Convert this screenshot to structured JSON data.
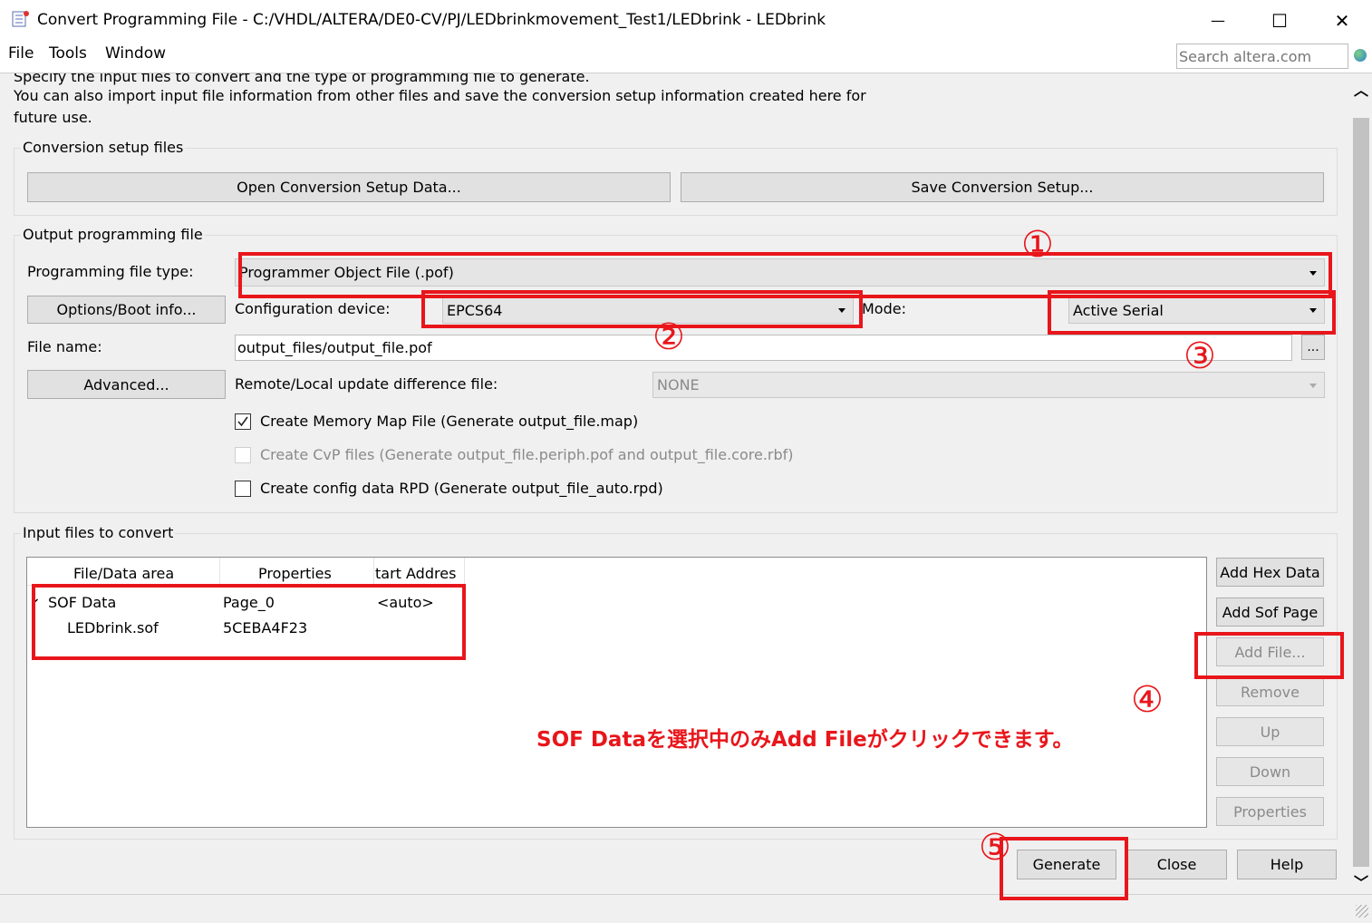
{
  "window": {
    "title": "Convert Programming File - C:/VHDL/ALTERA/DE0-CV/PJ/LEDbrinkmovement_Test1/LEDbrink - LEDbrink",
    "minimize_glyph": "—",
    "maximize_glyph": "☐",
    "close_glyph": "✕"
  },
  "menu": {
    "file": "File",
    "tools": "Tools",
    "window": "Window"
  },
  "search": {
    "placeholder": "Search altera.com"
  },
  "intro": {
    "line1": "Specify the input files to convert and the type of programming file to generate.",
    "line2": "You can also import input file information from other files and save the conversion setup information created here for",
    "line3": "future use."
  },
  "conversion_setup": {
    "title": "Conversion setup files",
    "open_button": "Open Conversion Setup Data...",
    "save_button": "Save Conversion Setup..."
  },
  "output": {
    "title": "Output programming file",
    "file_type_label": "Programming file type:",
    "file_type_value": "Programmer Object File (.pof)",
    "options_button": "Options/Boot info...",
    "config_device_label": "Configuration device:",
    "config_device_value": "EPCS64",
    "mode_label": "Mode:",
    "mode_value": "Active Serial",
    "file_name_label": "File name:",
    "file_name_value": "output_files/output_file.pof",
    "browse_button": "...",
    "advanced_button": "Advanced...",
    "remote_label": "Remote/Local update difference file:",
    "remote_value": "NONE",
    "chk_memory_map": "Create Memory Map File (Generate output_file.map)",
    "chk_cvp": "Create CvP files (Generate output_file.periph.pof and output_file.core.rbf)",
    "chk_rpd": "Create config data RPD (Generate output_file_auto.rpd)"
  },
  "input_files": {
    "title": "Input files to convert",
    "headers": [
      "File/Data area",
      "Properties",
      "tart Addres"
    ],
    "rows": [
      {
        "name": "SOF Data",
        "properties": "Page_0",
        "start": "<auto>"
      },
      {
        "name": "LEDbrink.sof",
        "properties": "5CEBA4F23",
        "start": ""
      }
    ],
    "expand_glyph": "⌄",
    "side_buttons": {
      "add_hex": "Add Hex Data",
      "add_sof": "Add Sof Page",
      "add_file": "Add File...",
      "remove": "Remove",
      "up": "Up",
      "down": "Down",
      "properties": "Properties"
    }
  },
  "bottom_buttons": {
    "generate": "Generate",
    "close": "Close",
    "help": "Help"
  },
  "annotations": {
    "n1": "①",
    "n2": "②",
    "n3": "③",
    "n4": "④",
    "n5": "⑤",
    "note": "SOF Dataを選択中のみAdd Fileがクリックできます。",
    "color": "#e8161b"
  },
  "scrollbar": {
    "up_glyph": "︿",
    "down_glyph": "﹀"
  }
}
